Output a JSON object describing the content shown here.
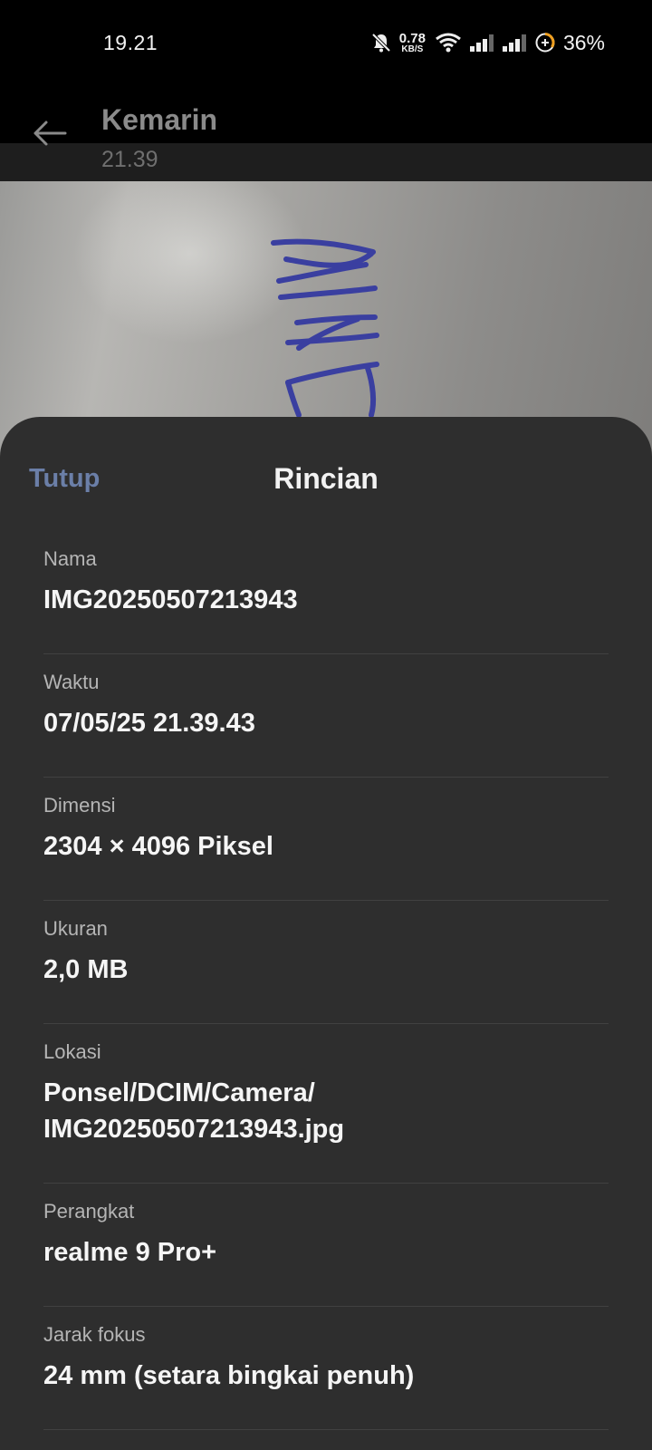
{
  "status_bar": {
    "time": "19.21",
    "net_speed_value": "0.78",
    "net_speed_unit": "KB/S",
    "battery_percent": "36%",
    "icons": [
      "mute-icon",
      "wifi-icon",
      "signal-icon",
      "signal-icon",
      "battery-saver-icon"
    ]
  },
  "header": {
    "title": "Kemarin",
    "subtitle": "21.39",
    "back_icon": "arrow-left-icon"
  },
  "sheet": {
    "close_label": "Tutup",
    "title": "Rincian",
    "rows": [
      {
        "label": "Nama",
        "value": "IMG20250507213943"
      },
      {
        "label": "Waktu",
        "value": "07/05/25 21.39.43"
      },
      {
        "label": "Dimensi",
        "value": "2304 × 4096 Piksel"
      },
      {
        "label": "Ukuran",
        "value": "2,0 MB"
      },
      {
        "label": "Lokasi",
        "value": "Ponsel/DCIM/Camera/\nIMG20250507213943.jpg"
      },
      {
        "label": "Perangkat",
        "value": "realme 9 Pro+"
      },
      {
        "label": "Jarak fokus",
        "value": "24 mm (setara bingkai penuh)"
      }
    ]
  },
  "colors": {
    "sheet_bg": "#2e2e2e",
    "close_accent": "#6b7fa8",
    "ink": "#3a3fa0"
  }
}
